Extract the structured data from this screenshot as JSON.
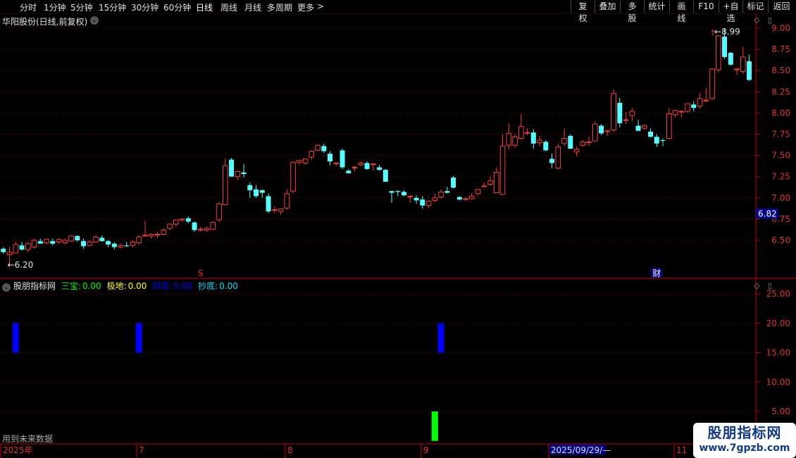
{
  "toolbar": {
    "periods": [
      {
        "label": "分时",
        "active": false
      },
      {
        "label": "1分钟",
        "active": false
      },
      {
        "label": "5分钟",
        "active": false
      },
      {
        "label": "15分钟",
        "active": false
      },
      {
        "label": "30分钟",
        "active": false
      },
      {
        "label": "60分钟",
        "active": false
      },
      {
        "label": "日线",
        "active": true
      },
      {
        "label": "周线",
        "active": false
      },
      {
        "label": "月线",
        "active": false
      },
      {
        "label": "多周期",
        "active": false
      },
      {
        "label": "更多",
        "active": false
      }
    ],
    "more_arrow": ">",
    "actions": [
      "复权",
      "叠加",
      "多股",
      "统计",
      "画线",
      "F10",
      "+自选",
      "标记",
      "返回"
    ]
  },
  "stock": {
    "title": "华阳股份(日线,前复权)",
    "chevron": "⌄"
  },
  "price_panel": {
    "y_ticks": [
      "9.00",
      "8.75",
      "8.50",
      "8.25",
      "8.00",
      "7.75",
      "7.50",
      "7.25",
      "7.00",
      "6.75",
      "6.50"
    ],
    "current_price": "6.82",
    "high_label": "8.99",
    "low_label": "6.20",
    "marker_s": "S",
    "marker_cai": "财"
  },
  "indicator": {
    "name": "股朋指标网",
    "items": [
      {
        "label": "三宝:",
        "value": "0.00",
        "color": "#00ff00"
      },
      {
        "label": "极地:",
        "value": "0.00",
        "color": "#ffff00"
      },
      {
        "label": "好底:",
        "value": "0.00",
        "color": "#0000ff"
      },
      {
        "label": "抄底:",
        "value": "0.00",
        "color": "#00e0ff"
      }
    ],
    "y_ticks": [
      "25.00",
      "20.00",
      "15.00",
      "10.00",
      "5.00"
    ]
  },
  "note": "用到未来数据",
  "x_axis": {
    "labels": [
      "2025年",
      "7",
      "8",
      "9",
      "2025/09/29/—",
      "11"
    ]
  },
  "watermark": {
    "title": "股朋指标网",
    "url": "www.7gpzb.com"
  },
  "colors": {
    "up": "#ff3c3c",
    "down": "#54ffff",
    "grid": "#7a0000",
    "axis": "#c00000",
    "tick_text": "#e03030",
    "bar_blue": "#0000ff",
    "bar_green": "#00ff00"
  },
  "chart_data": [
    {
      "type": "candlestick",
      "title": "华阳股份(日线,前复权)",
      "ylim": [
        6.2,
        9.0
      ],
      "y_ticks": [
        9.0,
        8.75,
        8.5,
        8.25,
        8.0,
        7.75,
        7.5,
        7.25,
        7.0,
        6.75,
        6.5
      ],
      "candles": [
        [
          6.4,
          6.42,
          6.34,
          6.36
        ],
        [
          6.33,
          6.42,
          6.2,
          6.36
        ],
        [
          6.35,
          6.48,
          6.35,
          6.45
        ],
        [
          6.44,
          6.48,
          6.38,
          6.39
        ],
        [
          6.39,
          6.48,
          6.36,
          6.46
        ],
        [
          6.42,
          6.52,
          6.4,
          6.5
        ],
        [
          6.49,
          6.52,
          6.46,
          6.46
        ],
        [
          6.47,
          6.52,
          6.45,
          6.51
        ],
        [
          6.49,
          6.52,
          6.44,
          6.46
        ],
        [
          6.48,
          6.52,
          6.46,
          6.51
        ],
        [
          6.47,
          6.52,
          6.45,
          6.5
        ],
        [
          6.49,
          6.56,
          6.48,
          6.55
        ],
        [
          6.55,
          6.56,
          6.48,
          6.5
        ],
        [
          6.49,
          6.52,
          6.4,
          6.43
        ],
        [
          6.44,
          6.5,
          6.43,
          6.48
        ],
        [
          6.48,
          6.56,
          6.48,
          6.54
        ],
        [
          6.53,
          6.56,
          6.48,
          6.49
        ],
        [
          6.49,
          6.5,
          6.42,
          6.45
        ],
        [
          6.46,
          6.48,
          6.39,
          6.42
        ],
        [
          6.42,
          6.46,
          6.4,
          6.44
        ],
        [
          6.44,
          6.48,
          6.42,
          6.43
        ],
        [
          6.44,
          6.5,
          6.42,
          6.48
        ],
        [
          6.47,
          6.56,
          6.45,
          6.54
        ],
        [
          6.55,
          6.73,
          6.54,
          6.56
        ],
        [
          6.55,
          6.58,
          6.52,
          6.57
        ],
        [
          6.57,
          6.6,
          6.53,
          6.57
        ],
        [
          6.57,
          6.64,
          6.56,
          6.62
        ],
        [
          6.64,
          6.7,
          6.62,
          6.69
        ],
        [
          6.69,
          6.74,
          6.66,
          6.74
        ],
        [
          6.74,
          6.76,
          6.72,
          6.75
        ],
        [
          6.76,
          6.78,
          6.7,
          6.72
        ],
        [
          6.71,
          6.72,
          6.6,
          6.62
        ],
        [
          6.62,
          6.66,
          6.6,
          6.63
        ],
        [
          6.62,
          6.66,
          6.6,
          6.64
        ],
        [
          6.63,
          6.72,
          6.62,
          6.71
        ],
        [
          6.74,
          6.95,
          6.72,
          6.93
        ],
        [
          6.92,
          7.46,
          6.92,
          7.38
        ],
        [
          7.45,
          7.47,
          7.33,
          7.25
        ],
        [
          7.25,
          7.31,
          7.21,
          7.31
        ],
        [
          7.3,
          7.4,
          7.24,
          7.28
        ],
        [
          7.15,
          7.18,
          7.0,
          7.09
        ],
        [
          7.1,
          7.15,
          7.0,
          7.02
        ],
        [
          7.09,
          7.1,
          7.0,
          7.06
        ],
        [
          7.02,
          7.05,
          6.82,
          6.84
        ],
        [
          6.86,
          6.9,
          6.82,
          6.86
        ],
        [
          6.84,
          6.87,
          6.8,
          6.87
        ],
        [
          6.88,
          7.1,
          6.86,
          7.05
        ],
        [
          7.08,
          7.43,
          7.05,
          7.42
        ],
        [
          7.42,
          7.45,
          7.39,
          7.44
        ],
        [
          7.41,
          7.46,
          7.39,
          7.46
        ],
        [
          7.48,
          7.56,
          7.45,
          7.55
        ],
        [
          7.56,
          7.63,
          7.55,
          7.62
        ],
        [
          7.61,
          7.64,
          7.53,
          7.55
        ],
        [
          7.52,
          7.55,
          7.38,
          7.43
        ],
        [
          7.4,
          7.42,
          7.38,
          7.41
        ],
        [
          7.56,
          7.58,
          7.34,
          7.36
        ],
        [
          7.32,
          7.34,
          7.29,
          7.29
        ],
        [
          7.36,
          7.38,
          7.31,
          7.36
        ],
        [
          7.39,
          7.43,
          7.37,
          7.41
        ],
        [
          7.41,
          7.43,
          7.33,
          7.34
        ],
        [
          7.4,
          7.41,
          7.32,
          7.4
        ],
        [
          7.36,
          7.39,
          7.32,
          7.33
        ],
        [
          7.33,
          7.34,
          7.19,
          7.19
        ],
        [
          7.08,
          7.08,
          6.94,
          7.06
        ],
        [
          7.08,
          7.09,
          7.02,
          7.07
        ],
        [
          7.07,
          7.09,
          7.02,
          7.03
        ],
        [
          7.01,
          7.03,
          6.94,
          7.02
        ],
        [
          7.0,
          7.03,
          6.93,
          6.97
        ],
        [
          6.98,
          7.02,
          6.87,
          6.91
        ],
        [
          6.91,
          6.97,
          6.88,
          6.96
        ],
        [
          6.97,
          7.05,
          6.95,
          7.0
        ],
        [
          7.01,
          7.1,
          6.99,
          7.07
        ],
        [
          7.08,
          7.13,
          7.05,
          7.06
        ],
        [
          7.24,
          7.26,
          7.11,
          7.12
        ],
        [
          7.01,
          7.02,
          6.97,
          6.98
        ],
        [
          6.98,
          7.01,
          6.96,
          6.99
        ],
        [
          6.99,
          7.06,
          6.98,
          7.02
        ],
        [
          7.05,
          7.11,
          7.03,
          7.1
        ],
        [
          7.14,
          7.18,
          7.13,
          7.14
        ],
        [
          7.16,
          7.25,
          7.14,
          7.2
        ],
        [
          7.06,
          7.36,
          7.06,
          7.3
        ],
        [
          7.04,
          7.75,
          7.04,
          7.61
        ],
        [
          7.62,
          7.88,
          7.57,
          7.76
        ],
        [
          7.62,
          7.75,
          7.59,
          7.72
        ],
        [
          7.7,
          7.99,
          7.69,
          7.84
        ],
        [
          7.77,
          7.82,
          7.74,
          7.77
        ],
        [
          7.77,
          7.81,
          7.58,
          7.64
        ],
        [
          7.65,
          7.73,
          7.61,
          7.68
        ],
        [
          7.66,
          7.68,
          7.55,
          7.56
        ],
        [
          7.46,
          7.52,
          7.35,
          7.41
        ],
        [
          7.35,
          7.64,
          7.33,
          7.6
        ],
        [
          7.64,
          7.82,
          7.61,
          7.7
        ],
        [
          7.73,
          7.75,
          7.59,
          7.58
        ],
        [
          7.54,
          7.6,
          7.49,
          7.57
        ],
        [
          7.62,
          7.68,
          7.6,
          7.66
        ],
        [
          7.66,
          7.72,
          7.61,
          7.66
        ],
        [
          7.67,
          7.9,
          7.66,
          7.87
        ],
        [
          7.85,
          7.87,
          7.74,
          7.76
        ],
        [
          7.78,
          7.8,
          7.73,
          7.79
        ],
        [
          7.8,
          8.28,
          7.78,
          8.23
        ],
        [
          8.12,
          8.18,
          7.83,
          7.88
        ],
        [
          7.92,
          8.01,
          7.87,
          7.92
        ],
        [
          7.97,
          8.06,
          7.9,
          8.02
        ],
        [
          7.85,
          7.92,
          7.79,
          7.79
        ],
        [
          7.82,
          7.87,
          7.8,
          7.85
        ],
        [
          7.78,
          7.82,
          7.71,
          7.72
        ],
        [
          7.72,
          7.75,
          7.6,
          7.64
        ],
        [
          7.68,
          7.7,
          7.61,
          7.67
        ],
        [
          7.7,
          8.06,
          7.7,
          7.99
        ],
        [
          7.98,
          8.04,
          7.95,
          8.03
        ],
        [
          8.02,
          8.03,
          7.95,
          8.02
        ],
        [
          8.02,
          8.11,
          8.0,
          8.11
        ],
        [
          8.1,
          8.14,
          8.02,
          8.06
        ],
        [
          8.08,
          8.24,
          8.05,
          8.17
        ],
        [
          8.15,
          8.3,
          8.13,
          8.15
        ],
        [
          8.17,
          8.53,
          8.15,
          8.52
        ],
        [
          8.51,
          8.91,
          8.48,
          8.91
        ],
        [
          8.9,
          8.99,
          8.64,
          8.66
        ],
        [
          8.71,
          8.72,
          8.56,
          8.57
        ],
        [
          8.51,
          8.53,
          8.45,
          8.52
        ],
        [
          8.49,
          8.78,
          8.46,
          8.66
        ],
        [
          8.61,
          8.69,
          8.38,
          8.39
        ]
      ]
    },
    {
      "type": "bar",
      "title": "股朋指标网",
      "ylim": [
        0,
        28
      ],
      "series": [
        {
          "name": "好底",
          "color": "#0000ff",
          "bars": [
            {
              "index": 2,
              "from": 15,
              "to": 20
            },
            {
              "index": 22,
              "from": 15,
              "to": 20
            },
            {
              "index": 71,
              "from": 15,
              "to": 20
            }
          ]
        },
        {
          "name": "三宝",
          "color": "#00ff00",
          "bars": [
            {
              "index": 70,
              "from": 0,
              "to": 5
            }
          ]
        }
      ]
    }
  ]
}
